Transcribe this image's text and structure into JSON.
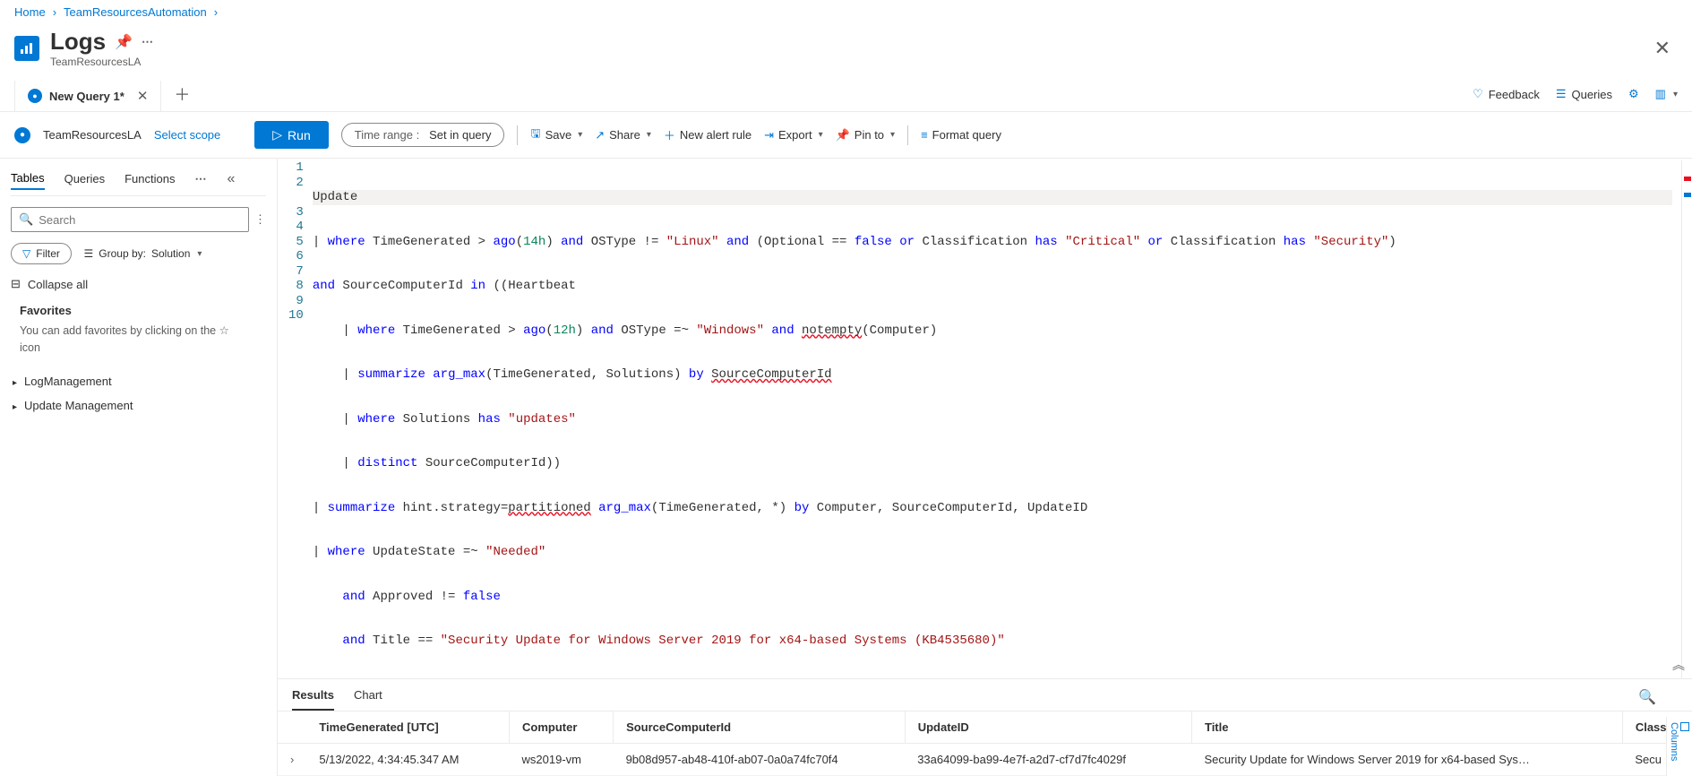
{
  "breadcrumb": {
    "home": "Home",
    "resource": "TeamResourcesAutomation"
  },
  "header": {
    "title": "Logs",
    "subtitle": "TeamResourcesLA"
  },
  "tab": {
    "query_label": "New Query 1*"
  },
  "topright": {
    "feedback": "Feedback",
    "queries": "Queries"
  },
  "scope": {
    "name": "TeamResourcesLA",
    "select": "Select scope"
  },
  "toolbar": {
    "run": "Run",
    "time_label": "Time range :",
    "time_value": "Set in query",
    "save": "Save",
    "share": "Share",
    "alert": "New alert rule",
    "export": "Export",
    "pin": "Pin to",
    "format": "Format query"
  },
  "sidebar": {
    "tabs": {
      "tables": "Tables",
      "queries": "Queries",
      "functions": "Functions"
    },
    "search_placeholder": "Search",
    "filter": "Filter",
    "group_label": "Group by:",
    "group_value": "Solution",
    "collapse_all": "Collapse all",
    "fav_title": "Favorites",
    "fav_text": "You can add favorites by clicking on the ☆ icon",
    "tree": {
      "log": "LogManagement",
      "update": "Update Management"
    }
  },
  "editor": {
    "lines": [
      "Update",
      "| where TimeGenerated > ago(14h) and OSType != \"Linux\" and (Optional == false or Classification has \"Critical\" or Classification has \"Security\")",
      "and SourceComputerId in ((Heartbeat",
      "    | where TimeGenerated > ago(12h) and OSType =~ \"Windows\" and notempty(Computer)",
      "    | summarize arg_max(TimeGenerated, Solutions) by SourceComputerId",
      "    | where Solutions has \"updates\"",
      "    | distinct SourceComputerId))",
      "| summarize hint.strategy=partitioned arg_max(TimeGenerated, *) by Computer, SourceComputerId, UpdateID",
      "| where UpdateState =~ \"Needed\"",
      "    and Approved != false",
      "    and Title == \"Security Update for Windows Server 2019 for x64-based Systems (KB4535680)\""
    ]
  },
  "results": {
    "tabs": {
      "results": "Results",
      "chart": "Chart"
    },
    "columns_label": "Columns",
    "headers": {
      "time": "TimeGenerated [UTC]",
      "computer": "Computer",
      "source": "SourceComputerId",
      "updateid": "UpdateID",
      "title": "Title",
      "class": "Class"
    },
    "row": {
      "time": "5/13/2022, 4:34:45.347 AM",
      "computer": "ws2019-vm",
      "source": "9b08d957-ab48-410f-ab07-0a0a74fc70f4",
      "updateid": "33a64099-ba99-4e7f-a2d7-cf7d7fc4029f",
      "title": "Security Update for Windows Server 2019 for x64-based Sys…",
      "class": "Secu"
    }
  }
}
